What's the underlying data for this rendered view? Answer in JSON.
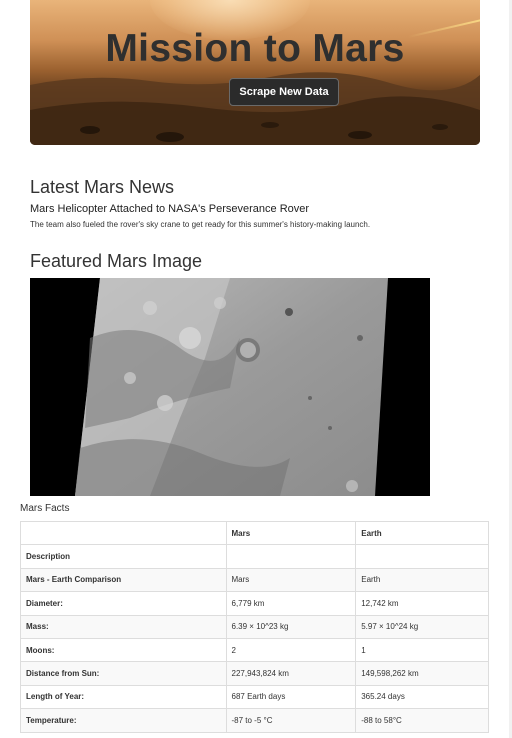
{
  "hero": {
    "title": "Mission to Mars",
    "scrape_button_label": "Scrape New Data"
  },
  "news": {
    "heading": "Latest Mars News",
    "title": "Mars Helicopter Attached to NASA's Perseverance Rover",
    "paragraph": "The team also fueled the rover's sky crane to get ready for this summer's history-making launch."
  },
  "featured": {
    "heading": "Featured Mars Image"
  },
  "facts": {
    "label": "Mars Facts",
    "columns": [
      "",
      "Mars",
      "Earth"
    ],
    "rows": [
      [
        "Description",
        "",
        ""
      ],
      [
        "Mars - Earth Comparison",
        "Mars",
        "Earth"
      ],
      [
        "Diameter:",
        "6,779 km",
        "12,742 km"
      ],
      [
        "Mass:",
        "6.39 × 10^23 kg",
        "5.97 × 10^24 kg"
      ],
      [
        "Moons:",
        "2",
        "1"
      ],
      [
        "Distance from Sun:",
        "227,943,824 km",
        "149,598,262 km"
      ],
      [
        "Length of Year:",
        "687 Earth days",
        "365.24 days"
      ],
      [
        "Temperature:",
        "-87 to -5 °C",
        "-88 to 58°C"
      ]
    ]
  }
}
